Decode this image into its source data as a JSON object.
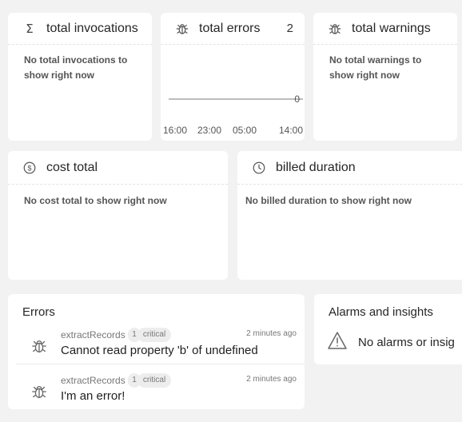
{
  "cards": {
    "invocations": {
      "title": "total invocations",
      "empty": "No total invocations to show right now",
      "icon": "sigma-icon",
      "glyph": "Σ"
    },
    "errors": {
      "title": "total errors",
      "count": "2",
      "icon": "bug-icon"
    },
    "warnings": {
      "title": "total warnings",
      "empty": "No total warnings to show right now",
      "icon": "bug-icon"
    },
    "cost": {
      "title": "cost total",
      "empty": "No cost total to show right now",
      "icon": "dollar-circle-icon"
    },
    "duration": {
      "title": "billed duration",
      "empty": "No billed duration to show right now",
      "icon": "clock-icon"
    }
  },
  "chart_data": {
    "type": "line",
    "x": [
      "16:00",
      "23:00",
      "05:00",
      "14:00"
    ],
    "series": [
      {
        "values": [
          0,
          0,
          0,
          0
        ]
      }
    ],
    "y_tick_labels": [
      "0"
    ],
    "title": "",
    "xlabel": "",
    "ylabel": "",
    "grid": false,
    "color": "#7a7a7a"
  },
  "errors_panel": {
    "title": "Errors",
    "items": [
      {
        "function": "extractRecords",
        "count": "1",
        "severity": "critical",
        "message": "Cannot read property 'b' of undefined",
        "time": "2 minutes ago"
      },
      {
        "function": "extractRecords",
        "count": "1",
        "severity": "critical",
        "message": "I'm an error!",
        "time": "2 minutes ago"
      }
    ]
  },
  "alarms_panel": {
    "title": "Alarms and insights",
    "empty": "No alarms or insig",
    "icon": "warning-triangle-icon"
  }
}
